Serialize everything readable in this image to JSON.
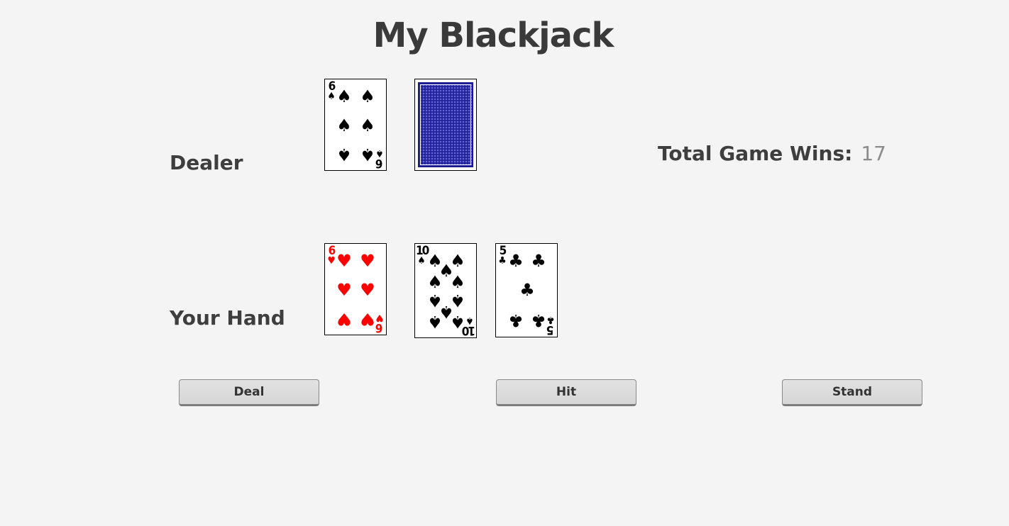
{
  "title": "My Blackjack",
  "dealer": {
    "label": "Dealer",
    "cards": [
      {
        "rank": "6",
        "suit": "♠",
        "color": "black",
        "face_up": true
      },
      {
        "face_up": false,
        "back_color": "#23239b"
      }
    ]
  },
  "player": {
    "label": "Your Hand",
    "cards": [
      {
        "rank": "6",
        "suit": "♥",
        "color": "red",
        "face_up": true
      },
      {
        "rank": "10",
        "suit": "♠",
        "color": "black",
        "face_up": true
      },
      {
        "rank": "5",
        "suit": "♣",
        "color": "black",
        "face_up": true
      }
    ]
  },
  "stats": {
    "wins_label": "Total Game Wins:",
    "wins_count": "17"
  },
  "buttons": {
    "deal": "Deal",
    "hit": "Hit",
    "stand": "Stand"
  },
  "colors": {
    "background": "#f4f4f4",
    "red_suit": "#ff0000",
    "card_back": "#23239b"
  }
}
